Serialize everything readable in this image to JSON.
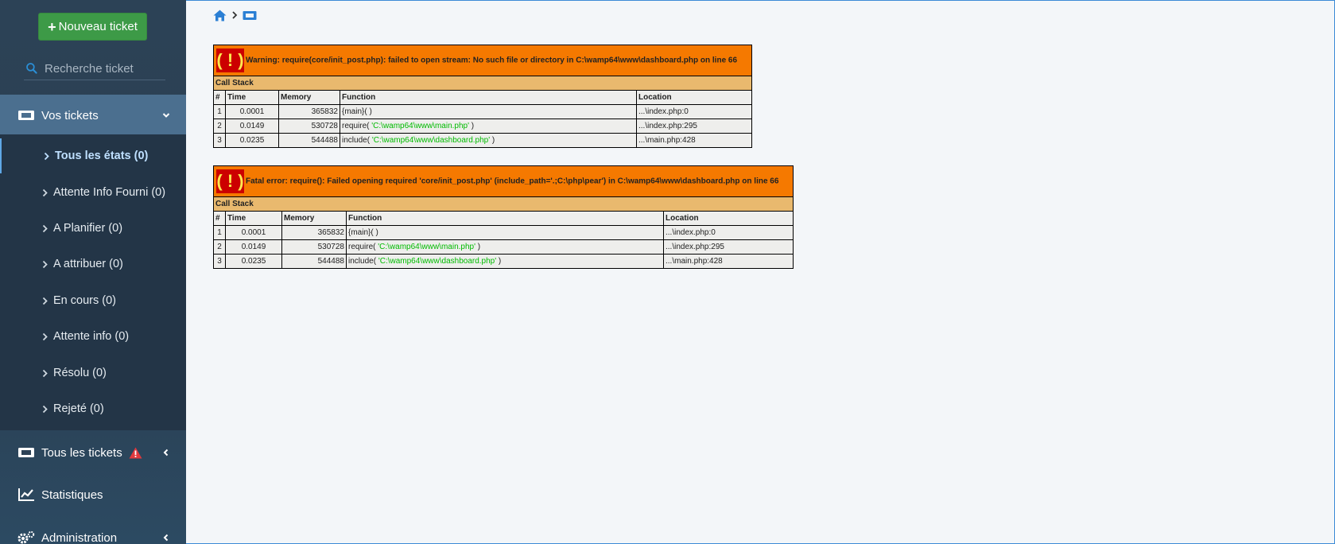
{
  "sidebar": {
    "new_ticket_label": "Nouveau ticket",
    "search_placeholder": "Recherche ticket",
    "sections": {
      "vos_tickets": "Vos tickets",
      "tous_tickets": "Tous les tickets",
      "statistiques": "Statistiques",
      "administration": "Administration"
    },
    "sub_items": [
      "Tous les états (0)",
      "Attente Info Fourni (0)",
      "A Planifier (0)",
      "A attribuer (0)",
      "En cours (0)",
      "Attente info (0)",
      "Résolu (0)",
      "Rejeté (0)"
    ]
  },
  "colors": {
    "sidebar_bg": "#2c4256",
    "active_section": "#4b6f8f",
    "new_ticket_green": "#3d9a47",
    "error_orange": "#f57900",
    "error_red": "#cc0000"
  },
  "breadcrumb": {
    "icons": [
      "home-icon",
      "chevron-right-icon",
      "ticket-icon"
    ]
  },
  "errors": [
    {
      "badge": "( ! )",
      "message": "Warning: require(core/init_post.php): failed to open stream: No such file or directory in C:\\wamp64\\www\\dashboard.php on line 66",
      "call_stack_label": "Call Stack",
      "headers": [
        "#",
        "Time",
        "Memory",
        "Function",
        "Location"
      ],
      "rows": [
        {
          "n": "1",
          "time": "0.0001",
          "memory": "365832",
          "func": "{main}( )",
          "arg": "",
          "func_end": "",
          "location": "...\\index.php:0"
        },
        {
          "n": "2",
          "time": "0.0149",
          "memory": "530728",
          "func": "require( ",
          "arg": "'C:\\wamp64\\www\\main.php'",
          "func_end": " )",
          "location": "...\\index.php:295"
        },
        {
          "n": "3",
          "time": "0.0235",
          "memory": "544488",
          "func": "include( ",
          "arg": "'C:\\wamp64\\www\\dashboard.php'",
          "func_end": " )",
          "location": "...\\main.php:428"
        }
      ]
    },
    {
      "badge": "( ! )",
      "message": "Fatal error: require(): Failed opening required 'core/init_post.php' (include_path='.;C:\\php\\pear') in C:\\wamp64\\www\\dashboard.php on line 66",
      "call_stack_label": "Call Stack",
      "headers": [
        "#",
        "Time",
        "Memory",
        "Function",
        "Location"
      ],
      "rows": [
        {
          "n": "1",
          "time": "0.0001",
          "memory": "365832",
          "func": "{main}( )",
          "arg": "",
          "func_end": "",
          "location": "...\\index.php:0"
        },
        {
          "n": "2",
          "time": "0.0149",
          "memory": "530728",
          "func": "require( ",
          "arg": "'C:\\wamp64\\www\\main.php'",
          "func_end": " )",
          "location": "...\\index.php:295"
        },
        {
          "n": "3",
          "time": "0.0235",
          "memory": "544488",
          "func": "include( ",
          "arg": "'C:\\wamp64\\www\\dashboard.php'",
          "func_end": " )",
          "location": "...\\main.php:428"
        }
      ]
    }
  ]
}
